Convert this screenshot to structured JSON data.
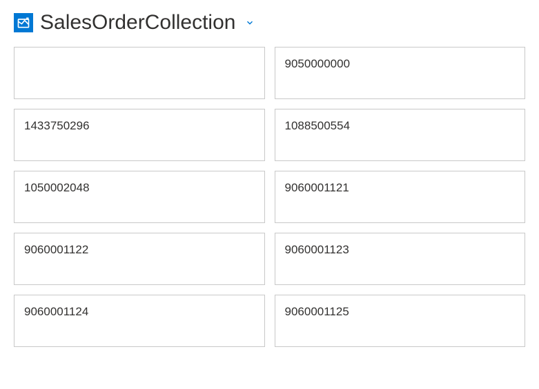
{
  "header": {
    "title": "SalesOrderCollection"
  },
  "cards": [
    {
      "value": ""
    },
    {
      "value": "9050000000"
    },
    {
      "value": "1433750296"
    },
    {
      "value": "1088500554"
    },
    {
      "value": "1050002048"
    },
    {
      "value": "9060001121"
    },
    {
      "value": "9060001122"
    },
    {
      "value": "9060001123"
    },
    {
      "value": "9060001124"
    },
    {
      "value": "9060001125"
    }
  ]
}
